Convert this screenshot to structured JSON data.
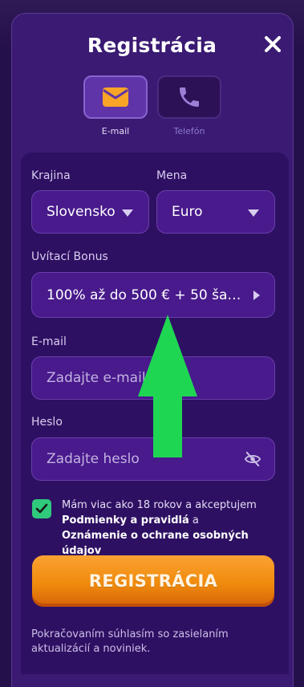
{
  "modal": {
    "title": "Registrácia",
    "tabs": [
      {
        "label": "E-mail",
        "icon": "envelope-icon",
        "active": true
      },
      {
        "label": "Telefón",
        "icon": "phone-icon",
        "active": false
      }
    ]
  },
  "form": {
    "country": {
      "label": "Krajina",
      "value": "Slovensko"
    },
    "currency": {
      "label": "Mena",
      "value": "Euro"
    },
    "bonus": {
      "label": "Uvítací Bonus",
      "value": "100% až do 500 € + 50 šanc..."
    },
    "email": {
      "label": "E-mail",
      "placeholder": "Zadajte e-mail"
    },
    "password": {
      "label": "Heslo",
      "placeholder": "Zadajte heslo"
    },
    "consent": {
      "checked": true,
      "text_plain": "Mám viac ako 18 rokov a akceptujem",
      "link1": "Podmienky a pravidlá",
      "connector": " a",
      "link2": "Oznámenie o ochrane osobných údajov"
    },
    "submit_label": "REGISTRÁCIA",
    "notice": "Pokračovaním súhlasím so zasielaním aktualizácií a noviniek."
  },
  "colors": {
    "accent_orange": "#f08b0c",
    "checkbox_green": "#2fca7c",
    "arrow_green": "#1fd653"
  }
}
